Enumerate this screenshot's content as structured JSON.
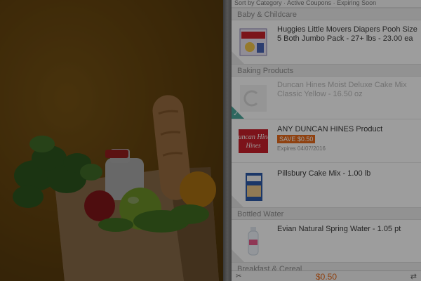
{
  "topbar": {
    "text": "Sort by Category · Active Coupons · Expiring Soon"
  },
  "sections": {
    "baby": "Baby & Childcare",
    "baking": "Baking Products",
    "water": "Bottled Water",
    "breakfast": "Breakfast & Cereal"
  },
  "items": {
    "huggies": {
      "title": "Huggies Little Movers Diapers Pooh Size 5 Both Jumbo Pack - 27+ lbs - 23.00 ea",
      "brand": "Huggies"
    },
    "duncan_classic": {
      "title": "Duncan Hines Moist Deluxe Cake Mix Classic Yellow - 16.50 oz"
    },
    "duncan_any": {
      "title": "ANY DUNCAN HINES Product",
      "save": "SAVE $0.50",
      "expires": "Expires 04/07/2016",
      "brand": "Duncan Hines"
    },
    "pillsbury": {
      "title": "Pillsbury Cake Mix - 1.00 lb"
    },
    "evian": {
      "title": "Evian Natural Spring Water - 1.05 pt"
    }
  },
  "bottom": {
    "total": "$0.50"
  },
  "colors": {
    "accent": "#e76a1a",
    "check": "#4aa79a"
  }
}
